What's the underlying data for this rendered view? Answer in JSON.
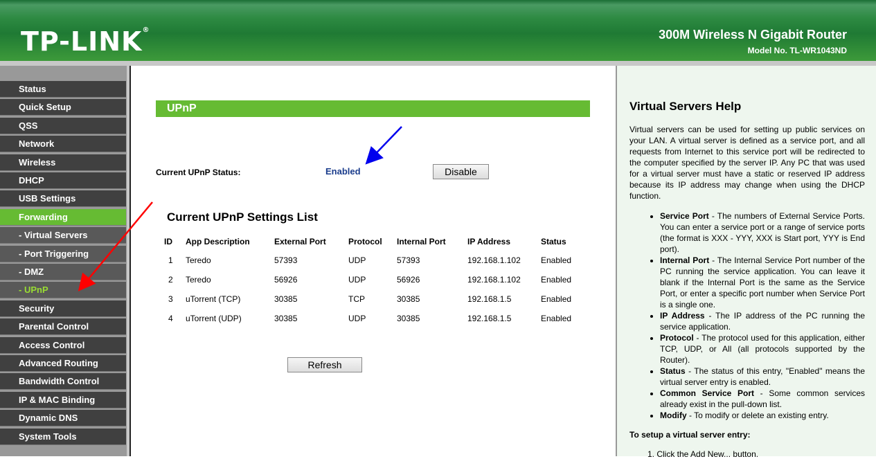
{
  "header": {
    "logo": "TP-LINK",
    "product": "300M Wireless N Gigabit Router",
    "model": "Model No. TL-WR1043ND"
  },
  "sidebar": {
    "items": [
      {
        "label": "Status",
        "type": "main"
      },
      {
        "label": "Quick Setup",
        "type": "main"
      },
      {
        "label": "QSS",
        "type": "main"
      },
      {
        "label": "Network",
        "type": "main"
      },
      {
        "label": "Wireless",
        "type": "main"
      },
      {
        "label": "DHCP",
        "type": "main"
      },
      {
        "label": "USB Settings",
        "type": "main"
      },
      {
        "label": "Forwarding",
        "type": "active"
      },
      {
        "label": "- Virtual Servers",
        "type": "sub"
      },
      {
        "label": "- Port Triggering",
        "type": "sub"
      },
      {
        "label": "- DMZ",
        "type": "sub"
      },
      {
        "label": "- UPnP",
        "type": "cur"
      },
      {
        "label": "Security",
        "type": "main"
      },
      {
        "label": "Parental Control",
        "type": "main"
      },
      {
        "label": "Access Control",
        "type": "main"
      },
      {
        "label": "Advanced Routing",
        "type": "main"
      },
      {
        "label": "Bandwidth Control",
        "type": "main"
      },
      {
        "label": "IP & MAC Binding",
        "type": "main"
      },
      {
        "label": "Dynamic DNS",
        "type": "main"
      },
      {
        "label": "System Tools",
        "type": "main"
      }
    ]
  },
  "main": {
    "banner": "UPnP",
    "status_label": "Current UPnP Status:",
    "status_value": "Enabled",
    "disable_label": "Disable",
    "list_title": "Current UPnP Settings List",
    "columns": [
      "ID",
      "App Description",
      "External Port",
      "Protocol",
      "Internal Port",
      "IP Address",
      "Status"
    ],
    "rows": [
      [
        "1",
        "Teredo",
        "57393",
        "UDP",
        "57393",
        "192.168.1.102",
        "Enabled"
      ],
      [
        "2",
        "Teredo",
        "56926",
        "UDP",
        "56926",
        "192.168.1.102",
        "Enabled"
      ],
      [
        "3",
        "uTorrent (TCP)",
        "30385",
        "TCP",
        "30385",
        "192.168.1.5",
        "Enabled"
      ],
      [
        "4",
        "uTorrent (UDP)",
        "30385",
        "UDP",
        "30385",
        "192.168.1.5",
        "Enabled"
      ]
    ],
    "refresh_label": "Refresh"
  },
  "help": {
    "title": "Virtual Servers Help",
    "intro": "Virtual servers can be used for setting up public services on your LAN. A virtual server is defined as a service port, and all requests from Internet to this service port will be redirected to the computer specified by the server IP. Any PC that was used for a virtual server must have a static or reserved IP address because its IP address may change when using the DHCP function.",
    "items": [
      {
        "term": "Service Port",
        "text": " - The numbers of External Service Ports. You can enter a service port or a range of service ports (the format is XXX - YYY, XXX is Start port, YYY is End port)."
      },
      {
        "term": "Internal Port",
        "text": " - The Internal Service Port number of the PC running the service application. You can leave it blank if the Internal Port is the same as the Service Port, or enter a specific port number when Service Port is a single one."
      },
      {
        "term": "IP Address",
        "text": " - The IP address of the PC running the service application."
      },
      {
        "term": "Protocol",
        "text": " - The protocol used for this application, either TCP, UDP, or All (all protocols supported by the Router)."
      },
      {
        "term": "Status",
        "text": " - The status of this entry, \"Enabled\" means the virtual server entry is enabled."
      },
      {
        "term": "Common Service Port",
        "text": " - Some common services already exist in the pull-down list."
      },
      {
        "term": "Modify",
        "text": " - To modify or delete an existing entry."
      }
    ],
    "setup_title": "To setup a virtual server entry:",
    "step1": "1.  Click the Add New... button."
  },
  "colors": {
    "header_green": "#2d8a42",
    "accent_green": "#66bb33",
    "menu_dark": "#404040",
    "status_blue": "#1a3c8c",
    "annotation_red": "#ff0000",
    "annotation_blue": "#0000ee"
  }
}
